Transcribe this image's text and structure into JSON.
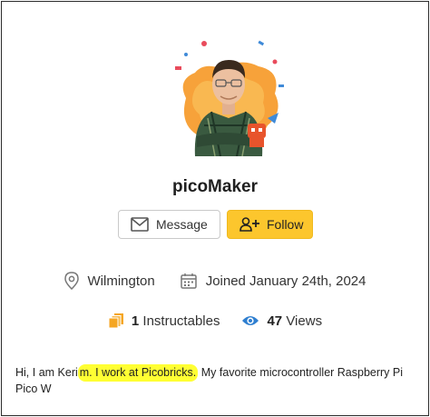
{
  "profile": {
    "username": "picoMaker",
    "location": "Wilmington",
    "joined": "Joined January 24th, 2024"
  },
  "actions": {
    "message_label": "Message",
    "follow_label": "Follow"
  },
  "stats": {
    "instructables_count": "1",
    "instructables_label": "Instructables",
    "views_count": "47",
    "views_label": "Views"
  },
  "bio": {
    "part1": "Hi, I am Keri",
    "highlight": "m. I work at Picobricks.",
    "part2": " My favorite microcontroller Raspberry Pi Pico W"
  },
  "colors": {
    "follow_bg": "#fcc62d",
    "stat_icon_orange": "#f5a623",
    "views_icon_blue": "#2f7fd0",
    "highlight": "#ffff33"
  },
  "icons": {
    "message": "envelope-icon",
    "follow": "person-plus-icon",
    "location": "map-pin-icon",
    "joined": "calendar-icon",
    "instructables": "documents-stack-icon",
    "views": "eye-icon"
  }
}
